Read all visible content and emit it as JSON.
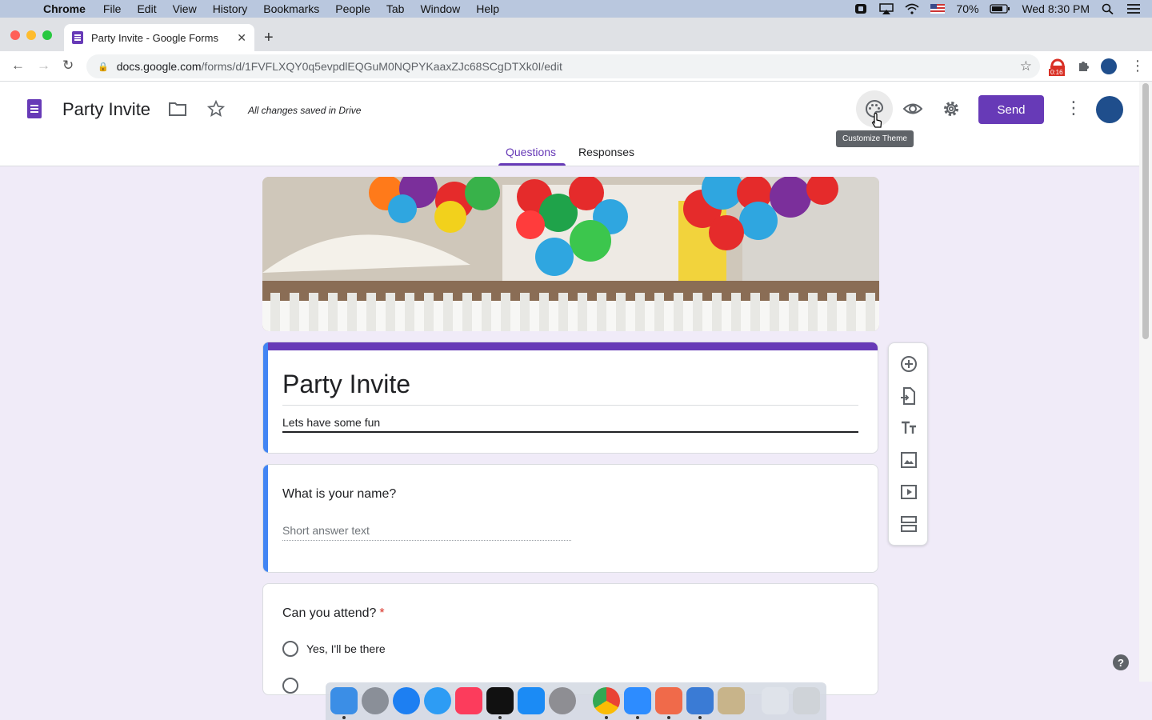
{
  "menubar": {
    "app": "Chrome",
    "items": [
      "File",
      "Edit",
      "View",
      "History",
      "Bookmarks",
      "People",
      "Tab",
      "Window",
      "Help"
    ],
    "battery": "70%",
    "clock": "Wed 8:30 PM"
  },
  "browser": {
    "tab_title": "Party Invite - Google Forms",
    "url_host": "docs.google.com",
    "url_path": "/forms/d/1FVFLXQY0q5evpdlEQGuM0NQPYKaaxZJc68SCgDTXk0I/edit",
    "ext_badge": "0:16"
  },
  "header": {
    "title": "Party Invite",
    "saved_status": "All changes saved in Drive",
    "send_label": "Send",
    "tooltip": "Customize Theme",
    "tabs": [
      "Questions",
      "Responses"
    ]
  },
  "form": {
    "title": "Party Invite",
    "description": "Lets have some fun",
    "questions": [
      {
        "title": "What is your name?",
        "placeholder": "Short answer text"
      },
      {
        "title": "Can you attend?",
        "required": "*",
        "options": [
          "Yes,  I'll be there"
        ]
      }
    ]
  },
  "help_label": "?",
  "colors": {
    "primary": "#673ab7",
    "accent": "#4285f4",
    "background": "#f0ebf8"
  }
}
